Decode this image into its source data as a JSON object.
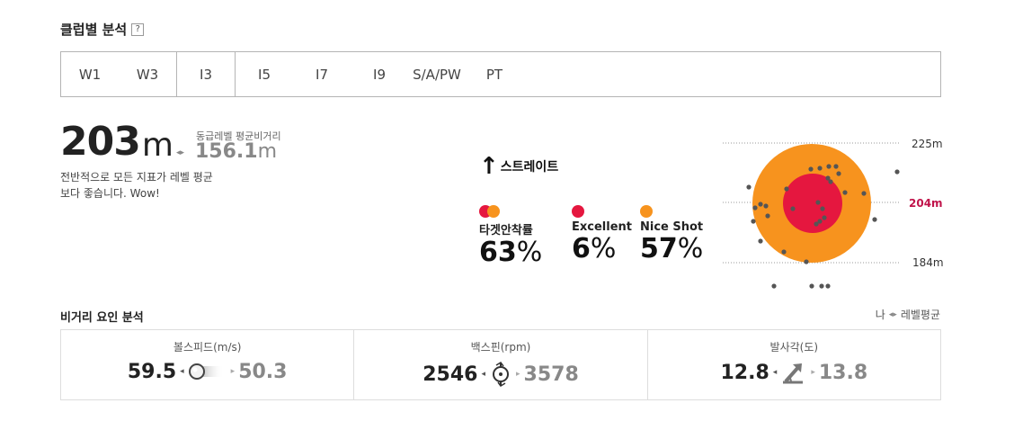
{
  "header": {
    "title": "클럽별 분석",
    "help_icon": "?"
  },
  "tabs": [
    {
      "label": "W1",
      "active": false
    },
    {
      "label": "W3",
      "active": false
    },
    {
      "label": "I3",
      "active": true
    },
    {
      "label": "I5",
      "active": false
    },
    {
      "label": "I7",
      "active": false
    },
    {
      "label": "I9",
      "active": false
    },
    {
      "label": "S/A/PW",
      "active": false
    },
    {
      "label": "PT",
      "active": false
    }
  ],
  "distance": {
    "mine_value": "203",
    "mine_unit": "m",
    "level_label": "동급레벨 평균비거리",
    "level_value": "156.1",
    "level_unit": "m",
    "desc_line1": "전반적으로 모든 지표가 레벨 평균",
    "desc_line2": "보다 좋습니다. Wow!"
  },
  "direction": {
    "arrow": "↑",
    "label": "스트레이트"
  },
  "stats": [
    {
      "label": "타겟안착률",
      "value": "63",
      "unit": "%"
    },
    {
      "label": "Excellent",
      "value": "6",
      "unit": "%"
    },
    {
      "label": "Nice Shot",
      "value": "57",
      "unit": "%"
    }
  ],
  "colors": {
    "red": "#e5173f",
    "orange": "#f7931e",
    "accent_label": "#c0134a",
    "dot": "#555555"
  },
  "target": {
    "top_label": "225m",
    "mid_label": "204m",
    "bottom_label": "184m"
  },
  "factors_section": {
    "title": "비거리 요인 분석",
    "legend_me": "나",
    "legend_level": "레벨평균"
  },
  "factors": [
    {
      "label": "볼스피드(m/s)",
      "mine": "59.5",
      "level": "50.3",
      "icon": "ball-speed-icon"
    },
    {
      "label": "백스핀(rpm)",
      "mine": "2546",
      "level": "3578",
      "icon": "backspin-icon"
    },
    {
      "label": "발사각(도)",
      "mine": "12.8",
      "level": "13.8",
      "icon": "launch-angle-icon"
    }
  ]
}
